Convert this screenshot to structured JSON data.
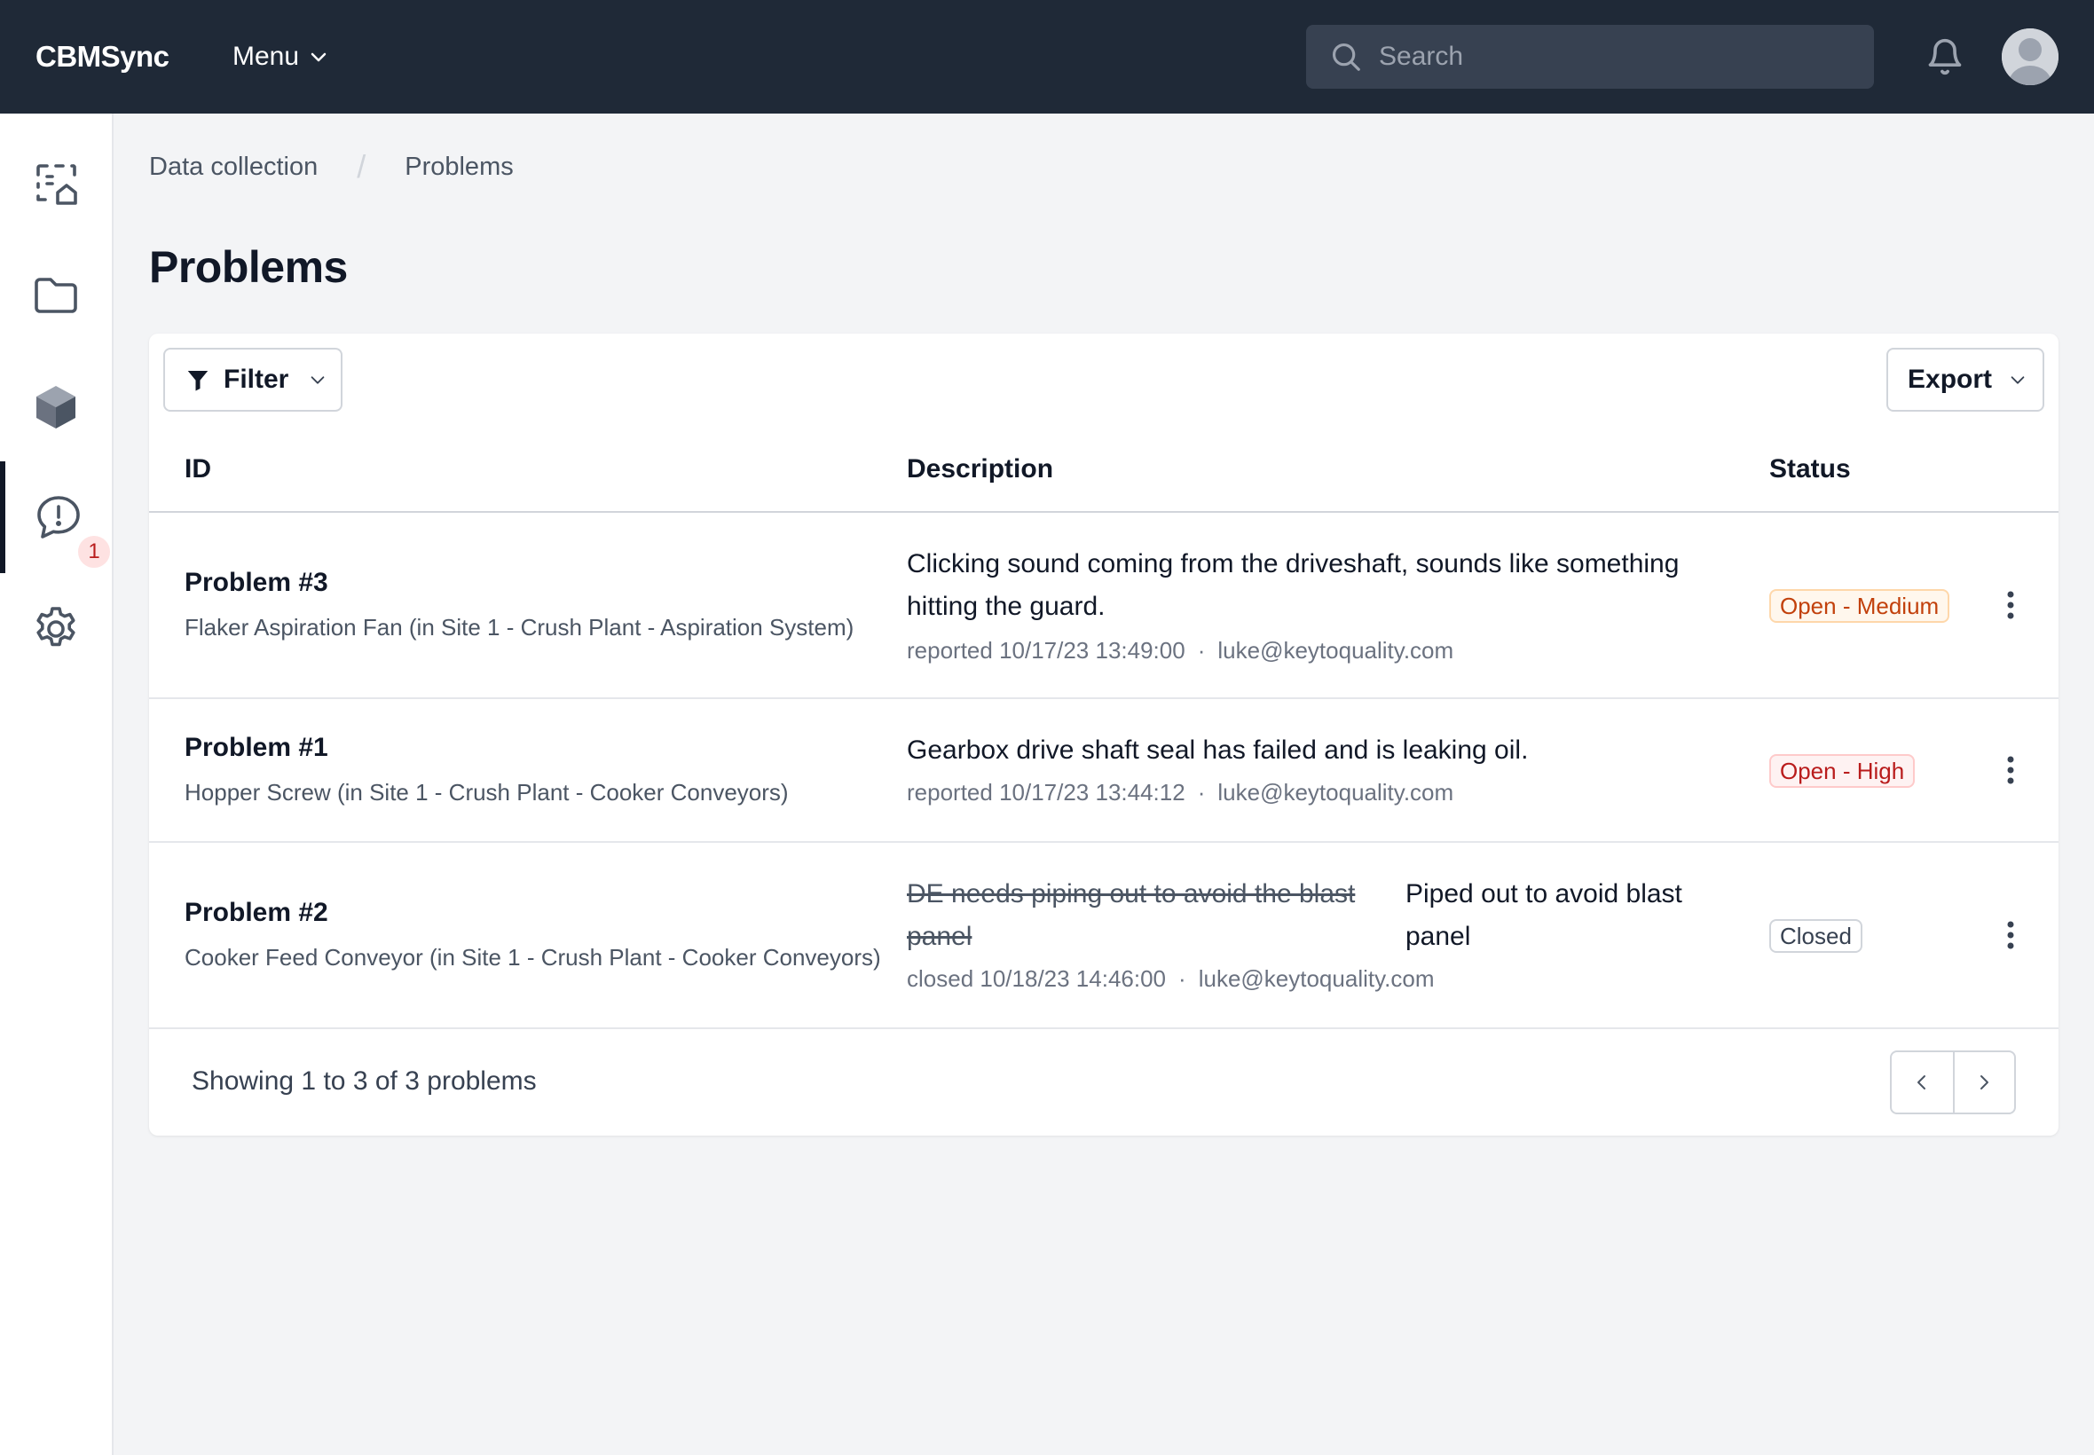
{
  "app": {
    "brand": "CBMSync"
  },
  "topbar": {
    "menu_label": "Menu",
    "search_placeholder": "Search"
  },
  "sidebar": {
    "items": [
      {
        "icon": "data-collection-icon"
      },
      {
        "icon": "folder-icon"
      },
      {
        "icon": "cube-icon"
      },
      {
        "icon": "problems-icon",
        "active": true,
        "badge": "1"
      },
      {
        "icon": "gear-icon"
      }
    ]
  },
  "breadcrumb": {
    "items": [
      "Data collection",
      "Problems"
    ]
  },
  "page": {
    "title": "Problems"
  },
  "toolbar": {
    "filter_label": "Filter",
    "export_label": "Export"
  },
  "table": {
    "columns": [
      "ID",
      "Description",
      "Status"
    ],
    "rows": [
      {
        "id": "Problem #3",
        "asset": "Flaker Aspiration Fan (in Site 1 - Crush Plant - Aspiration System)",
        "description": "Clicking sound coming from the driveshaft, sounds like something hitting the guard.",
        "meta_date": "reported 10/17/23 13:49:00",
        "meta_user": "luke@keytoquality.com",
        "status": "Open - Medium"
      },
      {
        "id": "Problem #1",
        "asset": "Hopper Screw (in Site 1 - Crush Plant - Cooker Conveyors)",
        "description": "Gearbox drive shaft seal has failed and is leaking oil.",
        "meta_date": "reported 10/17/23 13:44:12",
        "meta_user": "luke@keytoquality.com",
        "status": "Open - High"
      },
      {
        "id": "Problem #2",
        "asset": "Cooker Feed Conveyor (in Site 1 - Crush Plant - Cooker Conveyors)",
        "description_old_line1": "DE needs piping out to avoid the blast",
        "description_old_line2": "panel",
        "description_new_line1": "Piped out to avoid blast",
        "description_new_line2": "panel",
        "meta_date": "closed 10/18/23 14:46:00",
        "meta_user": "luke@keytoquality.com",
        "status": "Closed"
      }
    ]
  },
  "footer": {
    "showing_prefix": "Showing",
    "from": "1",
    "to_word": "to",
    "to": "3",
    "of_word": "of",
    "total": "3",
    "suffix": "problems"
  },
  "colors": {
    "topbar_bg": "#1f2937",
    "page_bg": "#f3f4f6",
    "medium_badge": "#c2410c",
    "high_badge": "#b91c1c"
  }
}
